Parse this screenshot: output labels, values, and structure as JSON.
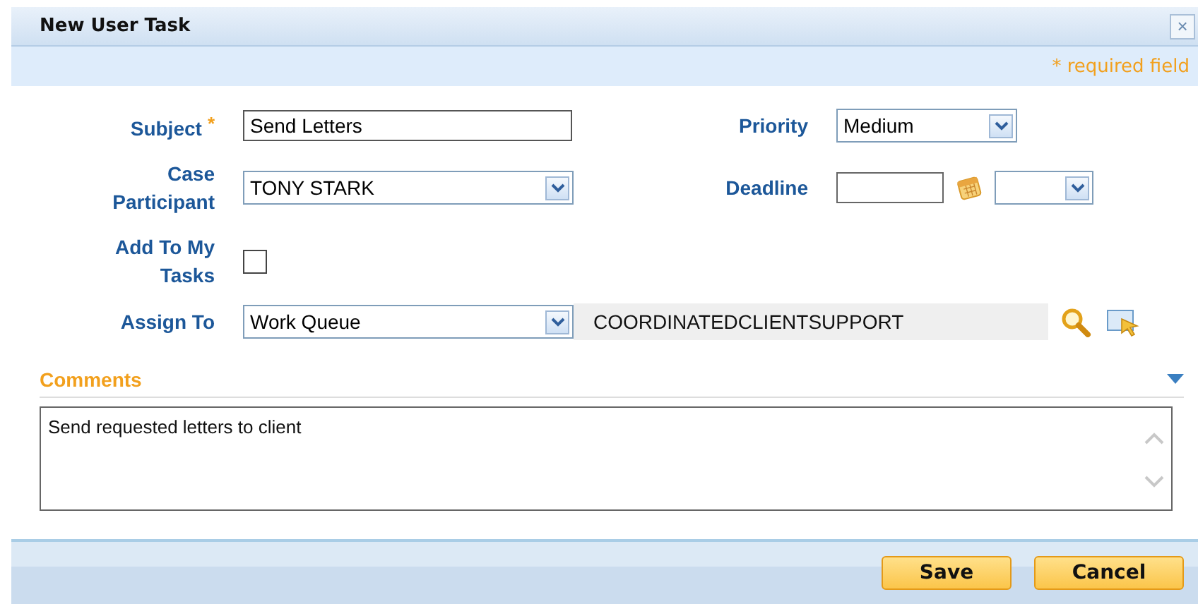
{
  "window": {
    "title": "New User Task",
    "close": "×"
  },
  "required_note": "* required field",
  "required_mark": "*",
  "subject": {
    "label": "Subject",
    "required": true,
    "value": "Send Letters"
  },
  "priority": {
    "label": "Priority",
    "value": "Medium"
  },
  "case_participant": {
    "label": "Case Participant",
    "value": "TONY STARK"
  },
  "deadline": {
    "label": "Deadline"
  },
  "add_to_my_tasks": {
    "label": "Add To My Tasks",
    "checked": false
  },
  "assign_to": {
    "label": "Assign To",
    "value": "Work Queue",
    "queue": "COORDINATEDCLIENTSUPPORT"
  },
  "comments": {
    "title": "Comments",
    "expanded": true,
    "value": "Send requested letters to client"
  },
  "buttons": [
    {
      "label": "Save"
    },
    {
      "label": "Cancel"
    }
  ]
}
